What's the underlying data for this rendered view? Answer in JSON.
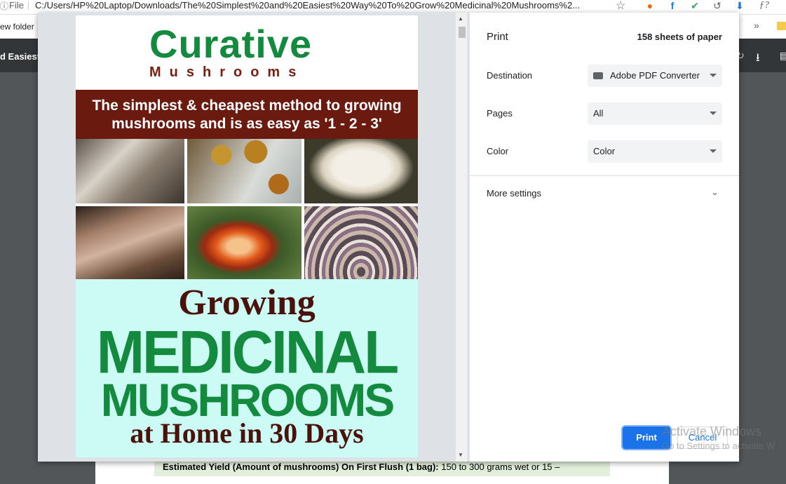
{
  "browser": {
    "file_label": "File",
    "url": "C:/Users/HP%20Laptop/Downloads/The%20Simplest%20and%20Easiest%20Way%20To%20Grow%20Medicinal%20Mushrooms%2...",
    "bookmark_folder": "ew folder",
    "bookmarks_more": "»",
    "extensions": [
      "sync-icon",
      "facebook-icon",
      "check-icon",
      "history-icon",
      "download-ext-icon",
      "function-icon"
    ],
    "ext_glyphs": [
      "●",
      "f",
      "✔",
      "↺",
      "⬇",
      "ƒ?"
    ],
    "ext_colors": [
      "#e8710a",
      "#1877f2",
      "#34a853",
      "#5f6368",
      "#1a73e8",
      "#5f6368"
    ]
  },
  "pdf_toolbar": {
    "title": "d Easiest"
  },
  "background_doc": {
    "label": "Estimated Yield (Amount of mushrooms) On First Flush (1 bag):",
    "value": "150 to 300 grams wet or 15 –"
  },
  "preview": {
    "logo_main": "Curative",
    "logo_sub": "Mushrooms",
    "banner_line1": "The simplest & cheapest method to growing",
    "banner_line2": "mushrooms and is as easy as '1 - 2 - 3'",
    "title_growing": "Growing",
    "title_medicinal": "MEDICINAL",
    "title_mushrooms": "MUSHROOMS",
    "title_athome": "at Home in 30 Days"
  },
  "print": {
    "title": "Print",
    "sheets": "158 sheets of paper",
    "destination_label": "Destination",
    "destination_value": "Adobe PDF Converter",
    "pages_label": "Pages",
    "pages_value": "All",
    "color_label": "Color",
    "color_value": "Color",
    "more_settings": "More settings",
    "print_button": "Print",
    "cancel_button": "Cancel"
  },
  "watermark": {
    "line1": "Activate Windows",
    "line2": "Go to Settings to activate W"
  },
  "colors": {
    "accent": "#1a73e8",
    "brand_green": "#138a3e",
    "brand_maroon": "#6b1a10",
    "preview_bg": "#ccfaf4"
  }
}
